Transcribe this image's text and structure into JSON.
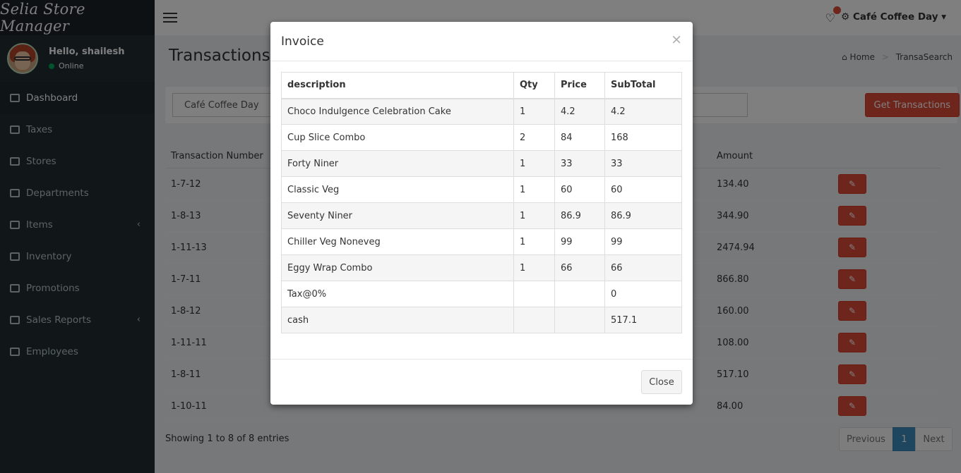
{
  "app": {
    "brand": "Selia Store Manager"
  },
  "user": {
    "greeting": "Hello, shailesh",
    "status": "Online"
  },
  "sidebar": {
    "items": [
      {
        "label": "Dashboard",
        "icon": "dashboard-icon",
        "active": true
      },
      {
        "label": "Taxes",
        "icon": "money-icon"
      },
      {
        "label": "Stores",
        "icon": "building-icon"
      },
      {
        "label": "Departments",
        "icon": "grid-icon"
      },
      {
        "label": "Items",
        "icon": "edit-icon",
        "expandable": true
      },
      {
        "label": "Inventory",
        "icon": "list-icon"
      },
      {
        "label": "Promotions",
        "icon": "tag-icon"
      },
      {
        "label": "Sales Reports",
        "icon": "bar-chart-icon",
        "expandable": true
      },
      {
        "label": "Employees",
        "icon": "user-icon"
      }
    ]
  },
  "header": {
    "store_menu": "Café Coffee Day"
  },
  "page": {
    "title": "Transactions",
    "breadcrumb": [
      "Home",
      "TransaSearch"
    ]
  },
  "filters": {
    "store": "Café Coffee Day",
    "date_placeholder": "e",
    "get_button": "Get Transactions"
  },
  "transactions": {
    "headers": {
      "number": "Transaction Number",
      "amount": "Amount"
    },
    "rows": [
      {
        "number": "1-7-12",
        "amount": "134.40"
      },
      {
        "number": "1-8-13",
        "amount": "344.90"
      },
      {
        "number": "1-11-13",
        "amount": "2474.94"
      },
      {
        "number": "1-7-11",
        "amount": "866.80"
      },
      {
        "number": "1-8-12",
        "amount": "160.00"
      },
      {
        "number": "1-11-11",
        "amount": "108.00"
      },
      {
        "number": "1-8-11",
        "amount": "517.10"
      },
      {
        "number": "1-10-11",
        "amount": "84.00"
      }
    ],
    "showing": "Showing 1 to 8 of 8 entries",
    "pager": {
      "prev": "Previous",
      "page": "1",
      "next": "Next"
    }
  },
  "modal": {
    "title": "Invoice",
    "close_x": "×",
    "columns": [
      "description",
      "Qty",
      "Price",
      "SubTotal"
    ],
    "rows": [
      [
        "Choco Indulgence Celebration Cake",
        "1",
        "4.2",
        "4.2"
      ],
      [
        "Cup Slice Combo",
        "2",
        "84",
        "168"
      ],
      [
        "Forty Niner",
        "1",
        "33",
        "33"
      ],
      [
        "Classic Veg",
        "1",
        "60",
        "60"
      ],
      [
        "Seventy Niner",
        "1",
        "86.9",
        "86.9"
      ],
      [
        "Chiller Veg Noneveg",
        "1",
        "99",
        "99"
      ],
      [
        "Eggy Wrap Combo",
        "1",
        "66",
        "66"
      ],
      [
        "Tax@0%",
        "",
        "",
        "0"
      ],
      [
        "cash",
        "",
        "",
        "517.1"
      ]
    ],
    "close_button": "Close"
  },
  "colors": {
    "sidebar_bg": "#222d32",
    "danger": "#dd4b39",
    "primary": "#3c8dbc"
  }
}
